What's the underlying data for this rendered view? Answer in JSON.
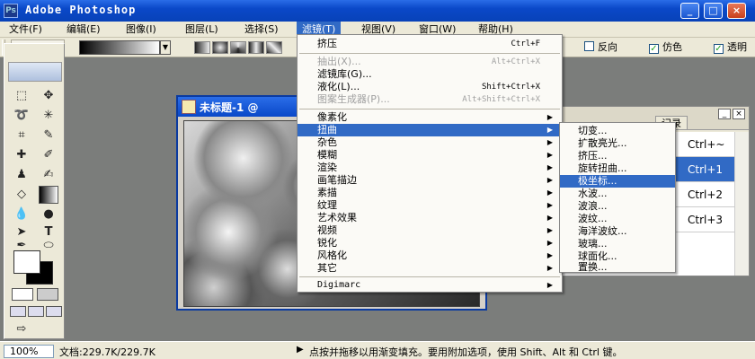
{
  "window": {
    "title": "Adobe Photoshop",
    "min_glyph": "_",
    "max_glyph": "□",
    "close_glyph": "×"
  },
  "menubar": {
    "items": [
      "文件(F)",
      "编辑(E)",
      "图像(I)",
      "图层(L)",
      "选择(S)",
      "滤镜(T)",
      "视图(V)",
      "窗口(W)",
      "帮助(H)"
    ],
    "active": "滤镜(T)"
  },
  "options": {
    "reverse_label": "反向",
    "reverse_checked": false,
    "dither_label": "仿色",
    "dither_checked": true,
    "transparency_label": "透明",
    "transparency_checked": true,
    "check_glyph": "✓"
  },
  "document": {
    "title": "未标题-1",
    "title_suffix": "@"
  },
  "filter_menu": {
    "items": [
      {
        "label": "挤压",
        "shortcut": "Ctrl+F",
        "disabled": false,
        "submenu": false
      },
      {
        "label": "抽出(X)...",
        "shortcut": "Alt+Ctrl+X",
        "disabled": true,
        "submenu": false
      },
      {
        "label": "滤镜库(G)...",
        "shortcut": "",
        "disabled": false,
        "submenu": false
      },
      {
        "label": "液化(L)...",
        "shortcut": "Shift+Ctrl+X",
        "disabled": false,
        "submenu": false
      },
      {
        "label": "图案生成器(P)...",
        "shortcut": "Alt+Shift+Ctrl+X",
        "disabled": true,
        "submenu": false
      },
      {
        "label": "像素化",
        "shortcut": "",
        "disabled": false,
        "submenu": true
      },
      {
        "label": "扭曲",
        "shortcut": "",
        "disabled": false,
        "submenu": true
      },
      {
        "label": "杂色",
        "shortcut": "",
        "disabled": false,
        "submenu": true
      },
      {
        "label": "模糊",
        "shortcut": "",
        "disabled": false,
        "submenu": true
      },
      {
        "label": "渲染",
        "shortcut": "",
        "disabled": false,
        "submenu": true
      },
      {
        "label": "画笔描边",
        "shortcut": "",
        "disabled": false,
        "submenu": true
      },
      {
        "label": "素描",
        "shortcut": "",
        "disabled": false,
        "submenu": true
      },
      {
        "label": "纹理",
        "shortcut": "",
        "disabled": false,
        "submenu": true
      },
      {
        "label": "艺术效果",
        "shortcut": "",
        "disabled": false,
        "submenu": true
      },
      {
        "label": "视频",
        "shortcut": "",
        "disabled": false,
        "submenu": true
      },
      {
        "label": "锐化",
        "shortcut": "",
        "disabled": false,
        "submenu": true
      },
      {
        "label": "风格化",
        "shortcut": "",
        "disabled": false,
        "submenu": true
      },
      {
        "label": "其它",
        "shortcut": "",
        "disabled": false,
        "submenu": true
      },
      {
        "label": "Digimarc",
        "shortcut": "",
        "disabled": false,
        "submenu": true
      }
    ],
    "highlighted": "扭曲",
    "arrow_glyph": "▶"
  },
  "distort_submenu": {
    "items": [
      "切变...",
      "扩散亮光...",
      "挤压...",
      "旋转扭曲...",
      "极坐标...",
      "水波...",
      "波浪...",
      "波纹...",
      "海洋波纹...",
      "玻璃...",
      "球面化...",
      "置换..."
    ],
    "highlighted": "极坐标..."
  },
  "history_panel": {
    "tab_label": "记录",
    "shortcuts": [
      "Ctrl+~",
      "Ctrl+1",
      "Ctrl+2",
      "Ctrl+3"
    ],
    "selected_index": 1
  },
  "statusbar": {
    "zoom": "100%",
    "doc_info": "文档:229.7K/229.7K",
    "hint": "点按并拖移以用渐变填充。要用附加选项，使用 Shift、Alt 和 Ctrl 键。"
  },
  "icons": {
    "app": "photoshop-app-icon",
    "gradient_tool": "gradient-tool-icon"
  }
}
